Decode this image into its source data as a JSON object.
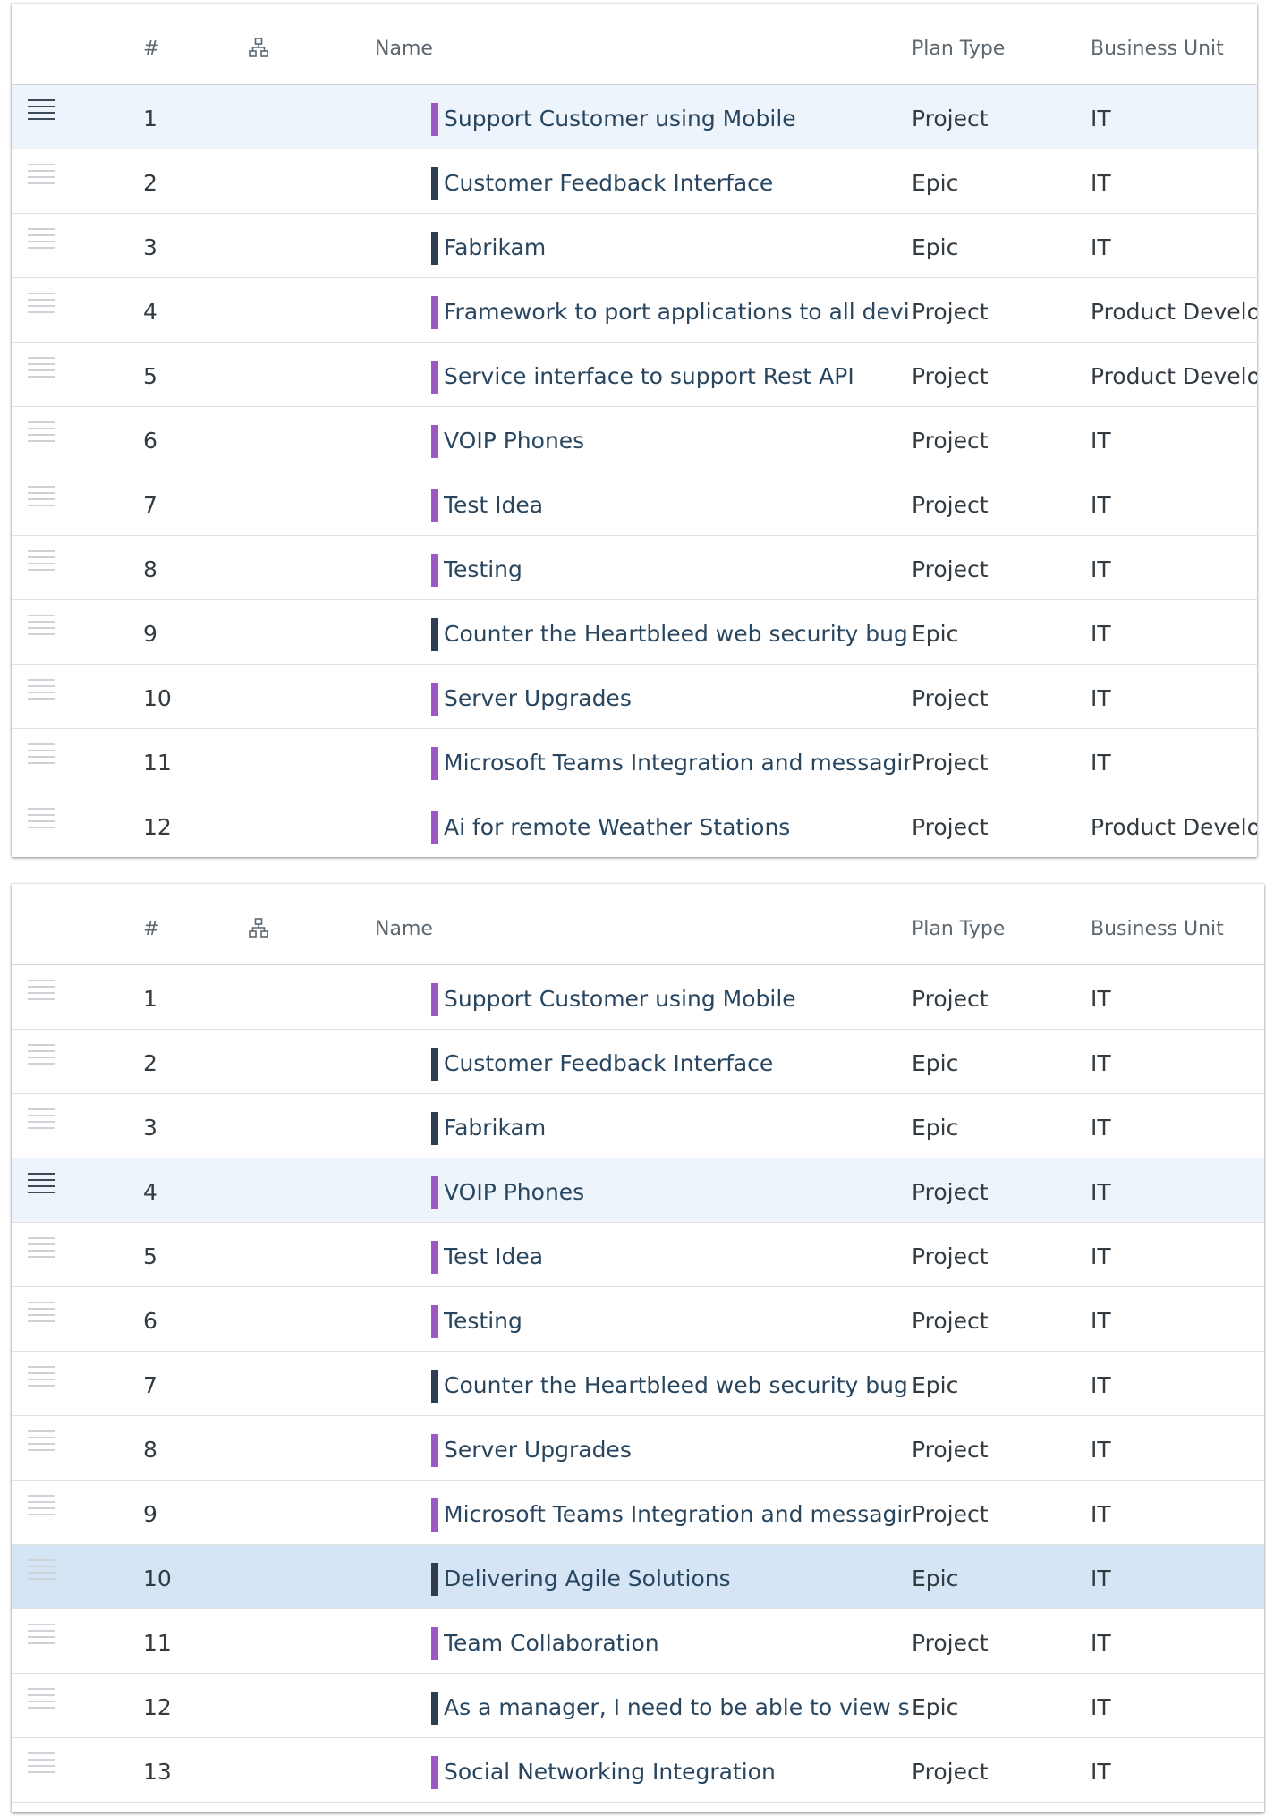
{
  "colors": {
    "project_bar": "#9b59c4",
    "epic_bar": "#2e3e50",
    "focused_row": "#eef4fb",
    "selected_row": "#d5e5f5"
  },
  "columns": {
    "number": "#",
    "hierarchy_icon": "hierarchy-icon",
    "name": "Name",
    "plan_type": "Plan Type",
    "business_unit": "Business Unit"
  },
  "grid1": {
    "rows": [
      {
        "n": "1",
        "name": "Support Customer using Mobile",
        "plan": "Project",
        "bu": "IT",
        "type": "project",
        "state": "focused"
      },
      {
        "n": "2",
        "name": "Customer Feedback Interface",
        "plan": "Epic",
        "bu": "IT",
        "type": "epic",
        "state": ""
      },
      {
        "n": "3",
        "name": "Fabrikam",
        "plan": "Epic",
        "bu": "IT",
        "type": "epic",
        "state": ""
      },
      {
        "n": "4",
        "name": "Framework to port applications to all devices",
        "plan": "Project",
        "bu": "Product Development",
        "type": "project",
        "state": ""
      },
      {
        "n": "5",
        "name": "Service interface to support Rest API",
        "plan": "Project",
        "bu": "Product Development",
        "type": "project",
        "state": ""
      },
      {
        "n": "6",
        "name": "VOIP Phones",
        "plan": "Project",
        "bu": "IT",
        "type": "project",
        "state": ""
      },
      {
        "n": "7",
        "name": "Test Idea",
        "plan": "Project",
        "bu": "IT",
        "type": "project",
        "state": ""
      },
      {
        "n": "8",
        "name": "Testing",
        "plan": "Project",
        "bu": "IT",
        "type": "project",
        "state": ""
      },
      {
        "n": "9",
        "name": "Counter the Heartbleed web security bug",
        "plan": "Epic",
        "bu": "IT",
        "type": "epic",
        "state": ""
      },
      {
        "n": "10",
        "name": "Server Upgrades",
        "plan": "Project",
        "bu": "IT",
        "type": "project",
        "state": ""
      },
      {
        "n": "11",
        "name": "Microsoft Teams Integration and messaging",
        "plan": "Project",
        "bu": "IT",
        "type": "project",
        "state": ""
      },
      {
        "n": "12",
        "name": "Ai for remote Weather Stations",
        "plan": "Project",
        "bu": "Product Development",
        "type": "project",
        "state": ""
      }
    ]
  },
  "grid2": {
    "rows": [
      {
        "n": "1",
        "name": "Support Customer using Mobile",
        "plan": "Project",
        "bu": "IT",
        "type": "project",
        "state": ""
      },
      {
        "n": "2",
        "name": "Customer Feedback Interface",
        "plan": "Epic",
        "bu": "IT",
        "type": "epic",
        "state": ""
      },
      {
        "n": "3",
        "name": "Fabrikam",
        "plan": "Epic",
        "bu": "IT",
        "type": "epic",
        "state": ""
      },
      {
        "n": "4",
        "name": "VOIP Phones",
        "plan": "Project",
        "bu": "IT",
        "type": "project",
        "state": "focused"
      },
      {
        "n": "5",
        "name": "Test Idea",
        "plan": "Project",
        "bu": "IT",
        "type": "project",
        "state": ""
      },
      {
        "n": "6",
        "name": "Testing",
        "plan": "Project",
        "bu": "IT",
        "type": "project",
        "state": ""
      },
      {
        "n": "7",
        "name": "Counter the Heartbleed web security bug",
        "plan": "Epic",
        "bu": "IT",
        "type": "epic",
        "state": ""
      },
      {
        "n": "8",
        "name": "Server Upgrades",
        "plan": "Project",
        "bu": "IT",
        "type": "project",
        "state": ""
      },
      {
        "n": "9",
        "name": "Microsoft Teams Integration and messaging",
        "plan": "Project",
        "bu": "IT",
        "type": "project",
        "state": ""
      },
      {
        "n": "10",
        "name": "Delivering Agile Solutions",
        "plan": "Epic",
        "bu": "IT",
        "type": "epic",
        "state": "selected"
      },
      {
        "n": "11",
        "name": "Team Collaboration",
        "plan": "Project",
        "bu": "IT",
        "type": "project",
        "state": ""
      },
      {
        "n": "12",
        "name": "As a manager, I need to be able to view sales",
        "plan": "Epic",
        "bu": "IT",
        "type": "epic",
        "state": ""
      },
      {
        "n": "13",
        "name": "Social Networking Integration",
        "plan": "Project",
        "bu": "IT",
        "type": "project",
        "state": ""
      }
    ]
  }
}
